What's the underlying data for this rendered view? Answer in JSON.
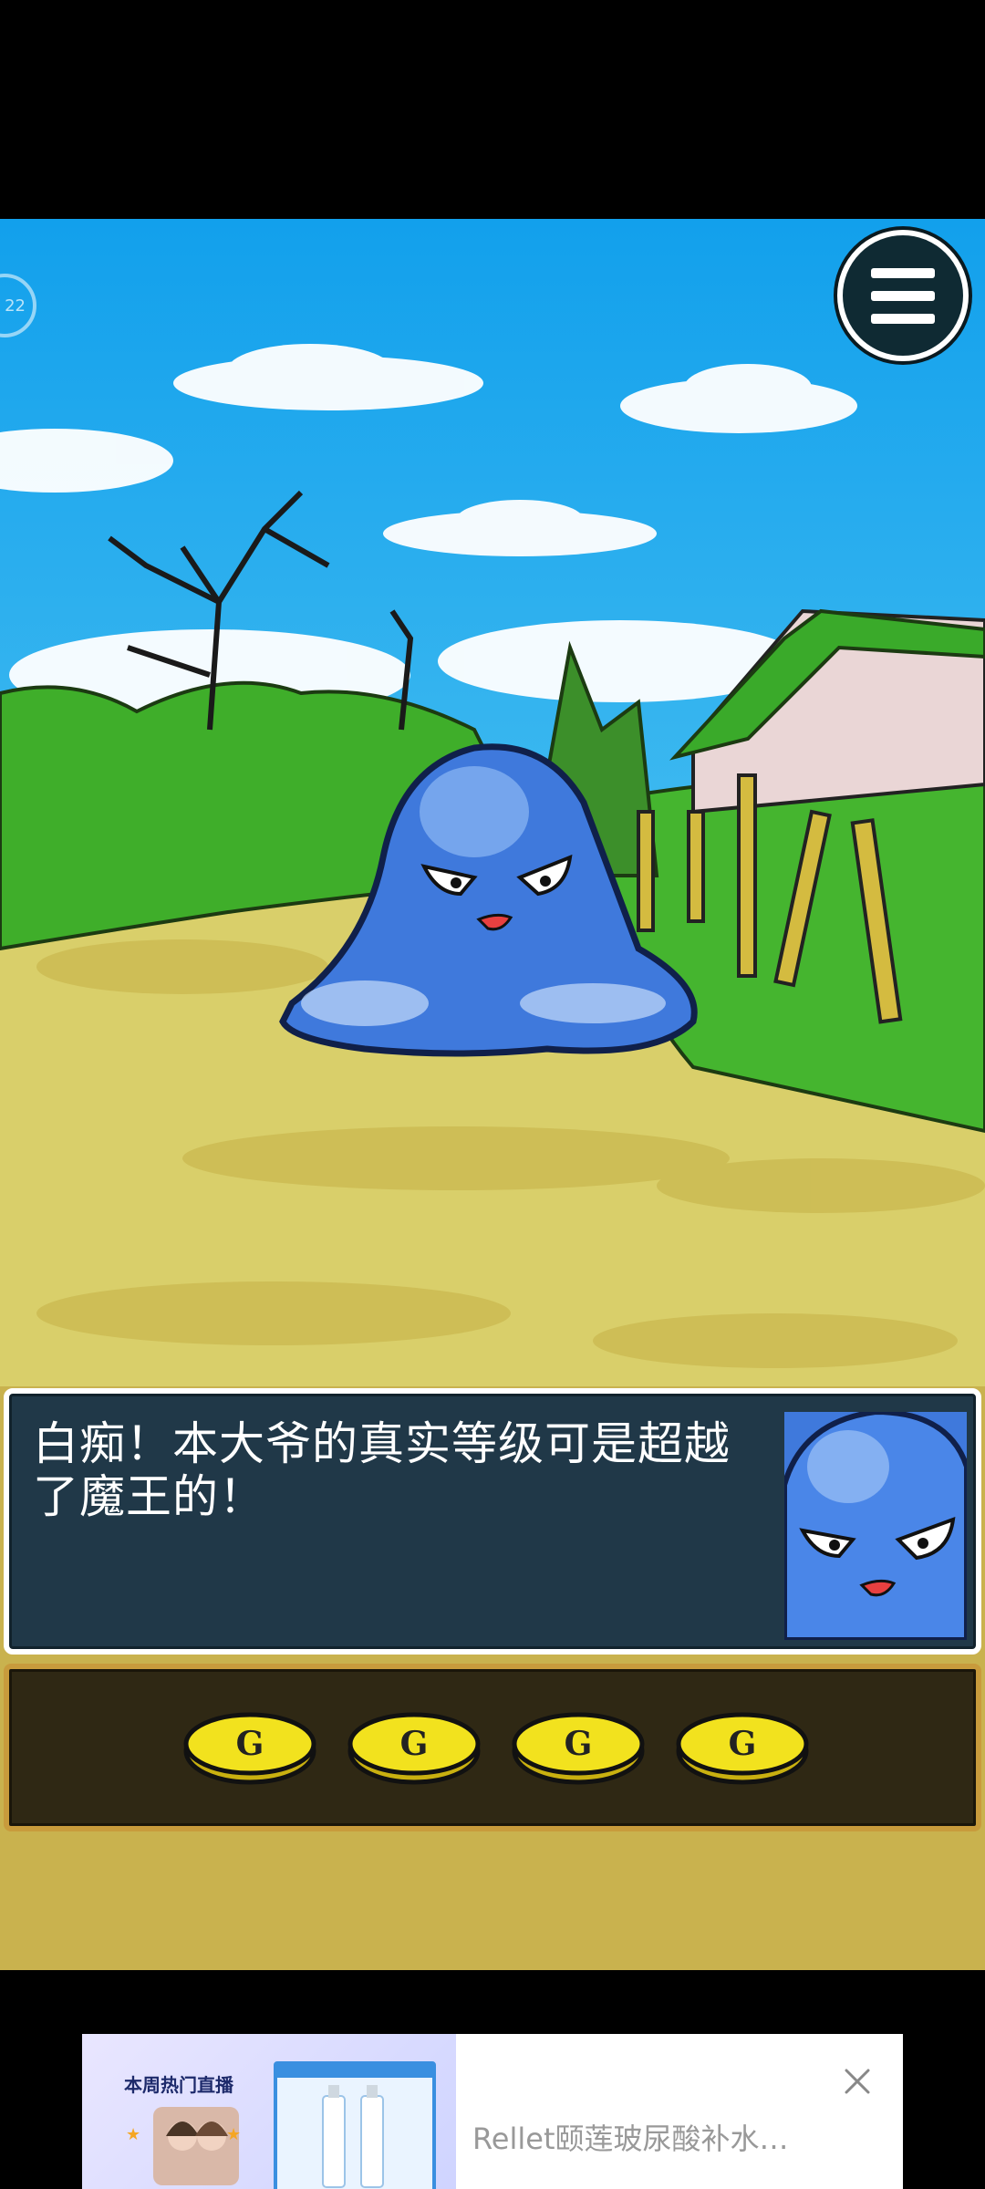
{
  "game": {
    "dialog_text": "白痴！本大爷的真实等级可是超越了魔王的！",
    "menu_icon": "hamburger-menu-icon",
    "coin_count": 4,
    "coin_symbol": "G"
  },
  "ad": {
    "live_title": "本周热门直播",
    "product_title": "Rellet颐莲玻尿酸补水…",
    "close_icon": "close-icon"
  },
  "colors": {
    "sky": "#1aa3e8",
    "grass": "#3fae2a",
    "ground": "#d9cf6a",
    "dialog_bg": "#203848",
    "coin_box_bg": "#2f2814",
    "coin": "#f2e21e",
    "slime": "#3f79dc"
  }
}
